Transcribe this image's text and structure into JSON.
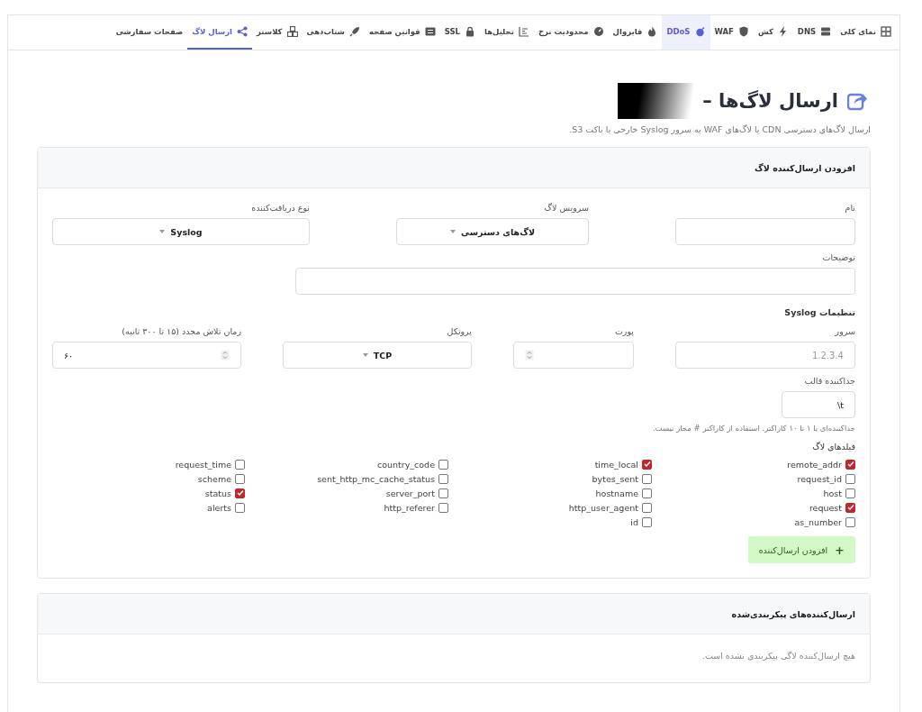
{
  "tabs": [
    {
      "label": "نمای کلی",
      "selected": false,
      "hovered": false
    },
    {
      "label": "DNS",
      "selected": false,
      "hovered": false
    },
    {
      "label": "کش",
      "selected": false,
      "hovered": false
    },
    {
      "label": "WAF",
      "selected": false,
      "hovered": false
    },
    {
      "label": "DDoS",
      "selected": false,
      "hovered": true
    },
    {
      "label": "فایروال",
      "selected": false,
      "hovered": false
    },
    {
      "label": "محدودیت نرخ",
      "selected": false,
      "hovered": false
    },
    {
      "label": "تحلیل‌ها",
      "selected": false,
      "hovered": false
    },
    {
      "label": "SSL",
      "selected": false,
      "hovered": false
    },
    {
      "label": "قوانین صفحه",
      "selected": false,
      "hovered": false
    },
    {
      "label": "شتاب‌دهی",
      "selected": false,
      "hovered": false
    },
    {
      "label": "کلاستر",
      "selected": false,
      "hovered": false
    },
    {
      "label": "ارسال لاگ",
      "selected": true,
      "hovered": false
    },
    {
      "label": "صفحات سفارشی",
      "selected": false,
      "hovered": false
    }
  ],
  "page": {
    "title": "ارسال لاگ‌ها –",
    "subtitle": "ارسال لاگ‌های دسترسی CDN یا لاگ‌های WAF به سرور Syslog خارجی یا باکت S3."
  },
  "add_card": {
    "title": "افزودن ارسال‌کننده لاگ",
    "name": {
      "label": "نام"
    },
    "service": {
      "label": "سرویس لاگ",
      "value": "لاگ‌های دسترسی"
    },
    "receiver": {
      "label": "نوع دریافت‌کننده",
      "value": "Syslog"
    },
    "description": {
      "label": "توضیحات"
    },
    "syslog_title": "تنظیمات Syslog",
    "server": {
      "label": "سرور",
      "placeholder": "1.2.3.4"
    },
    "port": {
      "label": "پورت"
    },
    "protocol": {
      "label": "پروتکل",
      "value": "TCP"
    },
    "retry": {
      "label": "زمان تلاش مجدد (۱۵ تا ۳۰۰ ثانیه)",
      "value": "۶۰"
    },
    "delimiter": {
      "label": "جداکننده قالب",
      "value": "\\t",
      "hint": "جداکننده‌ای با ۱ تا ۱۰ کاراکتر. استفاده از کاراکتر # مجاز نیست."
    },
    "fields_title": "فیلدهای لاگ",
    "field_columns": [
      [
        {
          "label": "remote_addr",
          "checked": true
        },
        {
          "label": "request_id",
          "checked": false
        },
        {
          "label": "host",
          "checked": false
        },
        {
          "label": "request",
          "checked": true
        },
        {
          "label": "as_number",
          "checked": false
        }
      ],
      [
        {
          "label": "time_local",
          "checked": true
        },
        {
          "label": "bytes_sent",
          "checked": false
        },
        {
          "label": "hostname",
          "checked": false
        },
        {
          "label": "http_user_agent",
          "checked": false
        },
        {
          "label": "id",
          "checked": false
        }
      ],
      [
        {
          "label": "country_code",
          "checked": false
        },
        {
          "label": "sent_http_mc_cache_status",
          "checked": false
        },
        {
          "label": "server_port",
          "checked": false
        },
        {
          "label": "http_referer",
          "checked": false
        }
      ],
      [
        {
          "label": "request_time",
          "checked": false
        },
        {
          "label": "scheme",
          "checked": false
        },
        {
          "label": "status",
          "checked": true
        },
        {
          "label": "alerts",
          "checked": false
        }
      ]
    ],
    "add_button": {
      "icon": "+",
      "label": "افزودن ارسال‌کننده"
    }
  },
  "list_card": {
    "title": "ارسال‌کننده‌های پیکربندی‌شده",
    "empty": "هیچ ارسال‌کننده لاگی پیکربندی نشده است."
  }
}
